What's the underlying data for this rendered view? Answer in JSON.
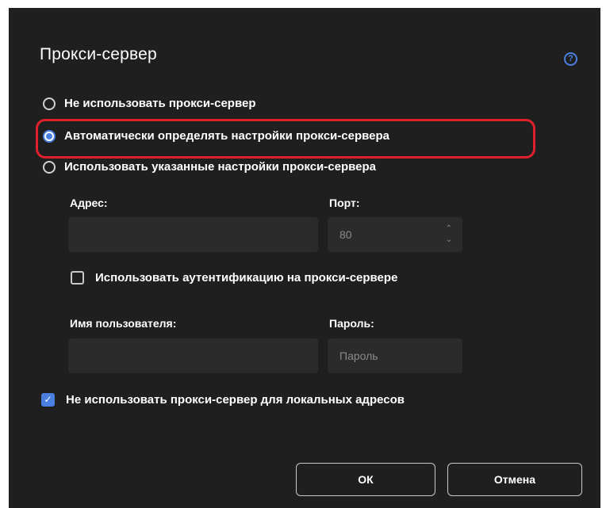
{
  "dialog": {
    "title": "Прокси-сервер",
    "help_icon": "help-circle-icon",
    "help_glyph": "?"
  },
  "proxy_mode": {
    "options": [
      {
        "label": "Не использовать прокси-сервер",
        "selected": false
      },
      {
        "label": "Автоматически определять настройки прокси-сервера",
        "selected": true
      },
      {
        "label": "Использовать указанные настройки прокси-сервера",
        "selected": false
      }
    ],
    "highlight_color": "#e0202a"
  },
  "manual": {
    "address_label": "Адрес:",
    "address_value": "",
    "port_label": "Порт:",
    "port_value": "80",
    "auth_label": "Использовать аутентификацию на прокси-сервере",
    "auth_checked": false,
    "username_label": "Имя пользователя:",
    "username_value": "",
    "password_label": "Пароль:",
    "password_placeholder": "Пароль"
  },
  "bypass_local": {
    "label": "Не использовать прокси-сервер для локальных адресов",
    "checked": true
  },
  "buttons": {
    "ok": "ОК",
    "cancel": "Отмена"
  },
  "colors": {
    "background": "#1f1f1f",
    "accent": "#4a7fe0",
    "field": "#2b2b2b"
  }
}
